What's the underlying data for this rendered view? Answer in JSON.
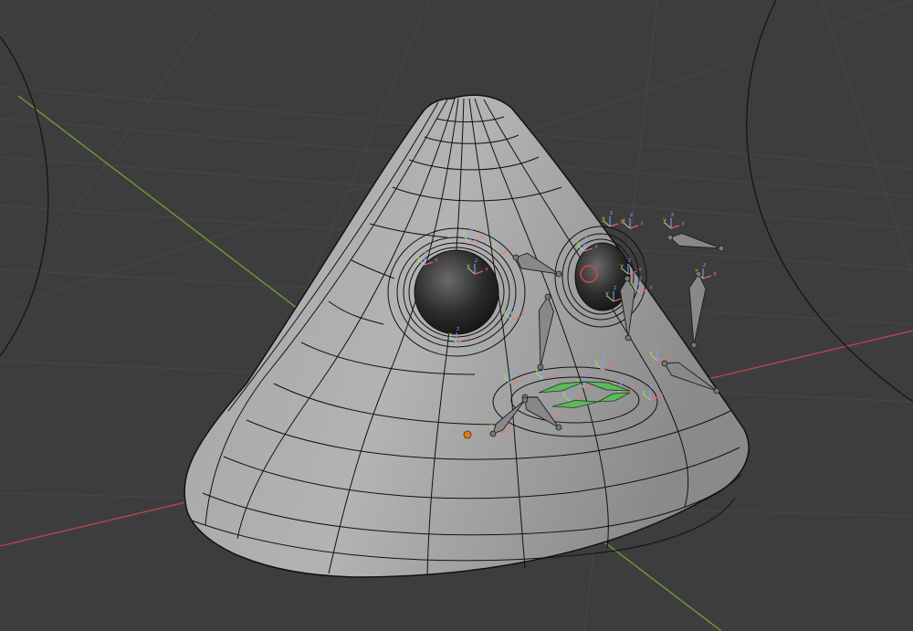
{
  "viewport": {
    "background": "#3d3d3d",
    "grid_color": "#4a4a4a",
    "x_axis_color": "#b8444f",
    "y_axis_color": "#6f9a3b"
  },
  "mesh": {
    "fill": "#9c9c9c",
    "wire_color": "#111111",
    "eye_color": "#2a2a2a"
  },
  "rig": {
    "bone_fill": "#888888",
    "bone_stroke": "#1a1a1a",
    "selected_bone_color": "#5fb95a",
    "origin_color": "#e07b19",
    "empty_axis_labels": [
      "x",
      "y",
      "z"
    ],
    "empty_axis_colors": {
      "x": "#ff6a6a",
      "y": "#a8e070",
      "z": "#7fa4ff"
    }
  },
  "icons": [
    "object-origin-icon",
    "empty-axes-icon",
    "bone-icon"
  ]
}
